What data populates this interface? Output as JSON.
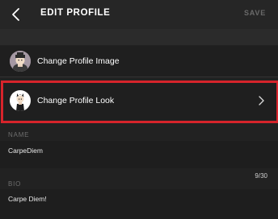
{
  "header": {
    "title": "EDIT PROFILE",
    "save_label": "SAVE",
    "back_icon": "chevron-left-icon"
  },
  "rows": {
    "profile_image": {
      "label": "Change Profile Image",
      "icon": "avatar-image"
    },
    "profile_look": {
      "label": "Change Profile Look",
      "icon": "avatar-look",
      "chevron": "chevron-right-icon"
    }
  },
  "name_field": {
    "label": "NAME",
    "value": "CarpeDiem"
  },
  "bio_field": {
    "label": "BIO",
    "value": "Carpe Diem!",
    "counter": "9/30"
  },
  "colors": {
    "background": "#222222",
    "highlight": "#d7242b",
    "save_disabled": "#6a6a6a"
  }
}
